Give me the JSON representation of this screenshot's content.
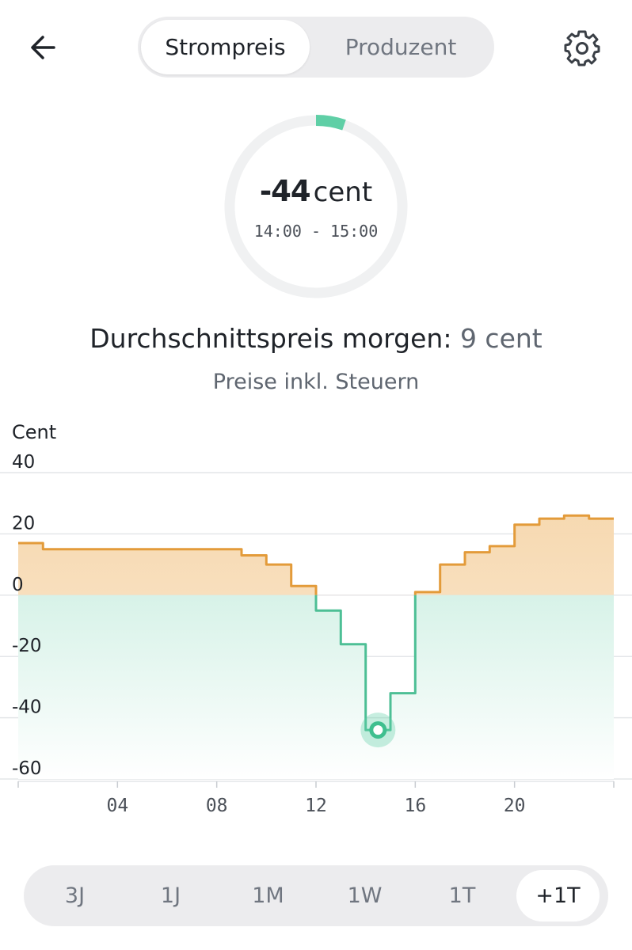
{
  "header": {
    "tabs": [
      {
        "label": "Strompreis",
        "active": true
      },
      {
        "label": "Produzent",
        "active": false
      }
    ],
    "back_icon": "arrow-left-icon",
    "settings_icon": "gear-icon"
  },
  "current": {
    "value": "-44",
    "unit": "cent",
    "time_range": "14:00 - 15:00",
    "accent_color": "#5fcfa6"
  },
  "summary": {
    "avg_label": "Durchschnittspreis morgen:",
    "avg_value": "9 cent",
    "note": "Preise inkl. Steuern"
  },
  "chart_data": {
    "type": "line",
    "ylabel": "Cent",
    "ylim": [
      -60,
      40
    ],
    "y_ticks": [
      40,
      20,
      0,
      -20,
      -40,
      -60
    ],
    "x_ticks": [
      "04",
      "08",
      "12",
      "16",
      "20"
    ],
    "x_range": [
      0,
      24
    ],
    "grid": true,
    "step": true,
    "positive_color": "#e39b3a",
    "negative_color": "#4dbf95",
    "series": [
      {
        "x": [
          0,
          1,
          2,
          3,
          4,
          5,
          6,
          7,
          8,
          9,
          10,
          11,
          12,
          13,
          14,
          15,
          16,
          17,
          18,
          19,
          20,
          21,
          22,
          23
        ],
        "values": [
          17,
          15,
          15,
          15,
          15,
          15,
          15,
          15,
          15,
          13,
          10,
          3,
          -5,
          -16,
          -44,
          -32,
          1,
          10,
          14,
          16,
          23,
          25,
          26,
          25
        ]
      }
    ],
    "highlight": {
      "x": 14.5,
      "value": -44
    }
  },
  "ranges": {
    "items": [
      {
        "label": "3J",
        "active": false
      },
      {
        "label": "1J",
        "active": false
      },
      {
        "label": "1M",
        "active": false
      },
      {
        "label": "1W",
        "active": false
      },
      {
        "label": "1T",
        "active": false
      },
      {
        "label": "+1T",
        "active": true
      }
    ]
  }
}
